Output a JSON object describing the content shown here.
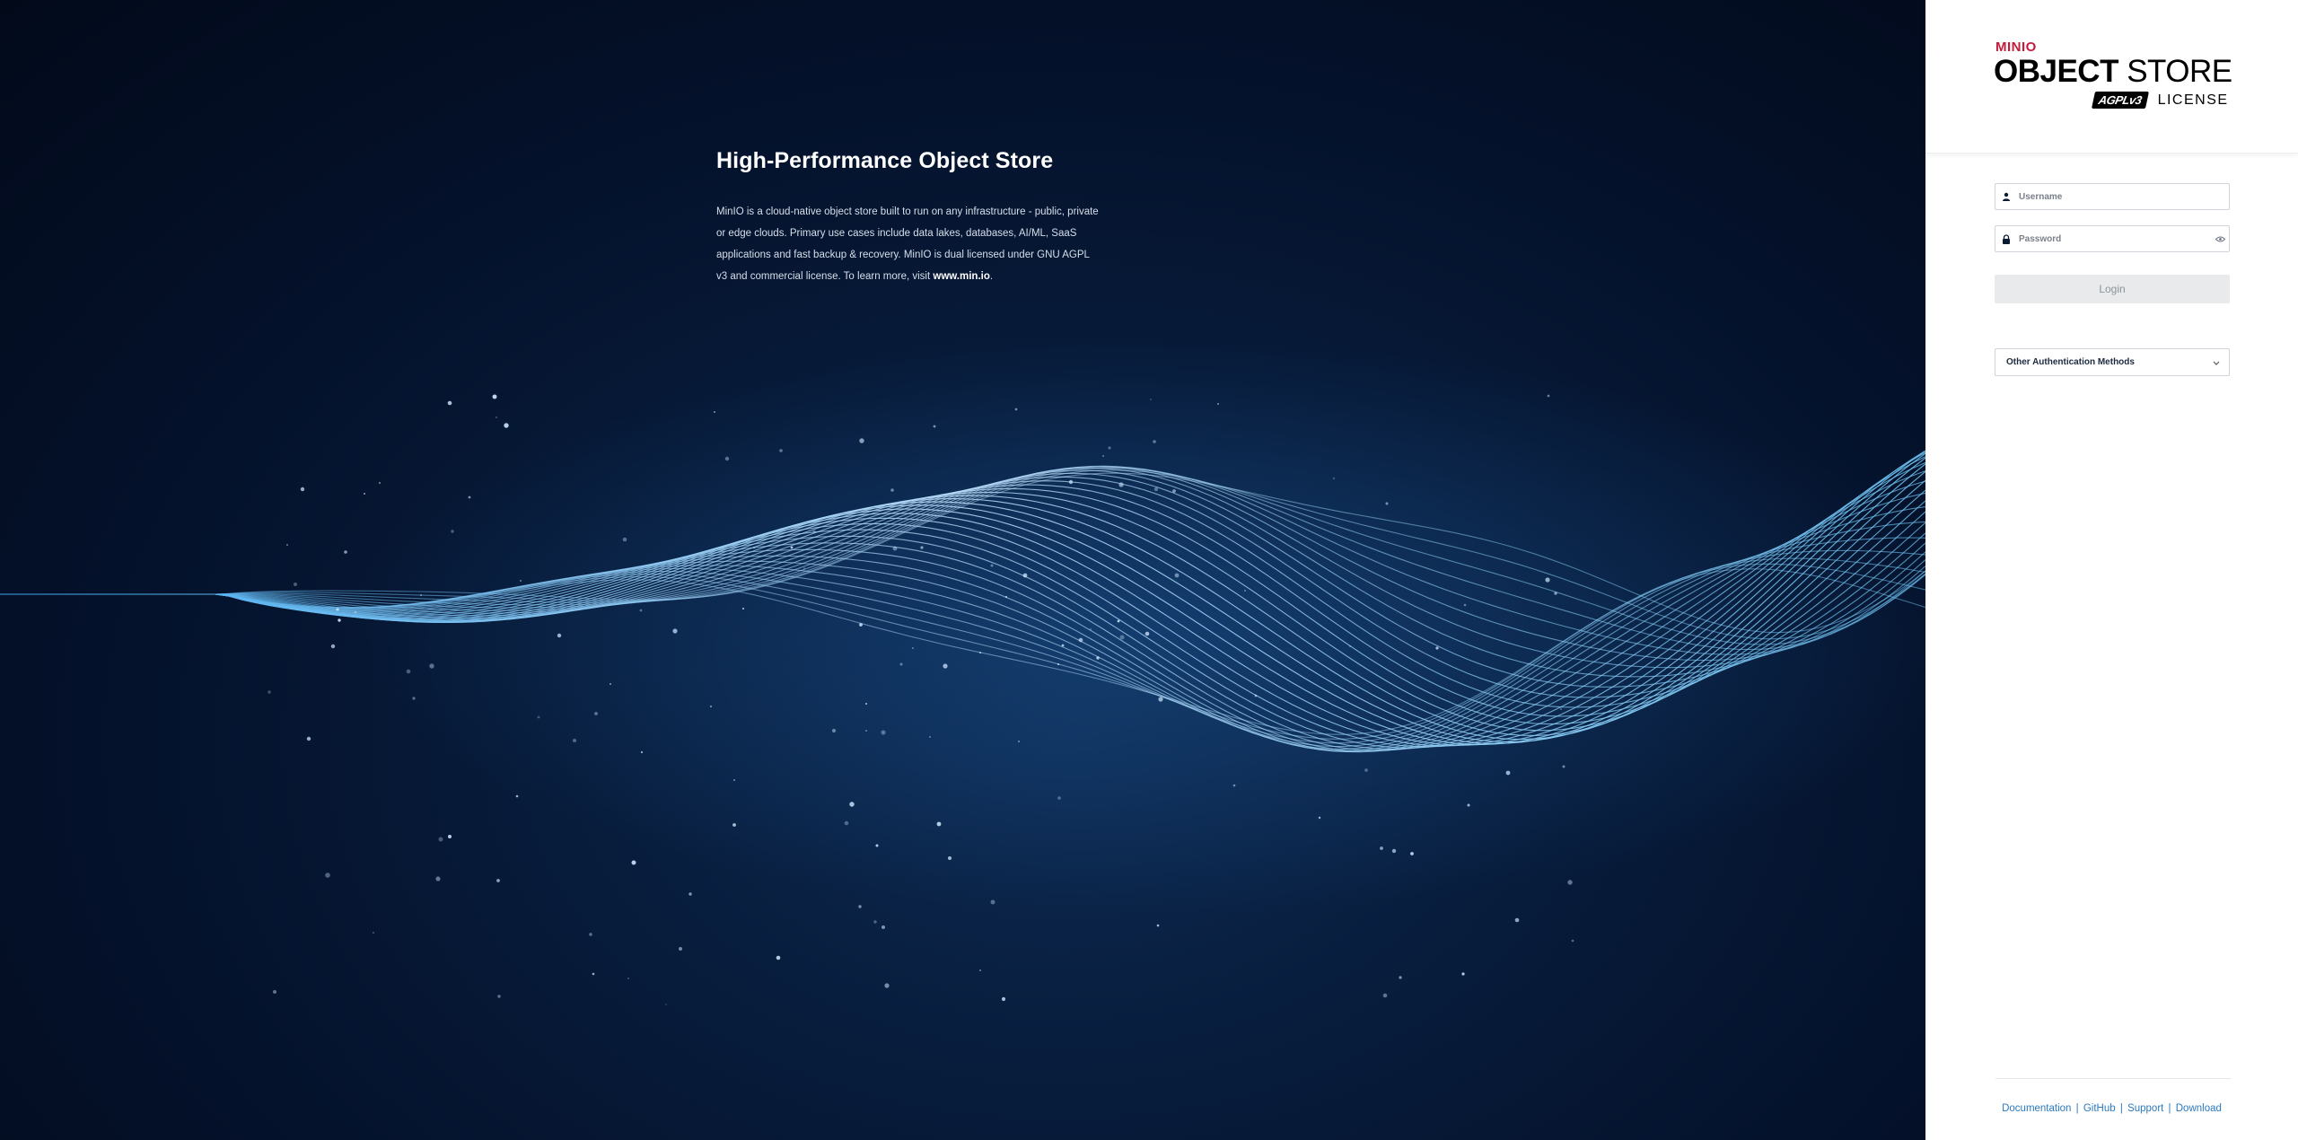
{
  "hero": {
    "title": "High-Performance Object Store",
    "description": "MinIO is a cloud-native object store built to run on any infrastructure - public, private or edge clouds. Primary use cases include data lakes, databases, AI/ML, SaaS applications and fast backup & recovery. MinIO is dual licensed under GNU AGPL v3 and commercial license. To learn more, visit",
    "link_text": "www.min.io",
    "link_suffix": "."
  },
  "logo": {
    "brand": "MINIO",
    "product_strong": "OBJECT",
    "product_light": "STORE",
    "badge": "AGPLv3",
    "license": "LICENSE"
  },
  "form": {
    "username_placeholder": "Username",
    "password_placeholder": "Password",
    "login_label": "Login",
    "other_auth_label": "Other Authentication Methods"
  },
  "footer": {
    "links": [
      "Documentation",
      "GitHub",
      "Support",
      "Download"
    ],
    "separator": "|"
  },
  "colors": {
    "brand_red": "#c51b3a",
    "hero_bg": "#04112a",
    "wave": "#5fb8ee",
    "link_blue": "#2a7ac0"
  }
}
